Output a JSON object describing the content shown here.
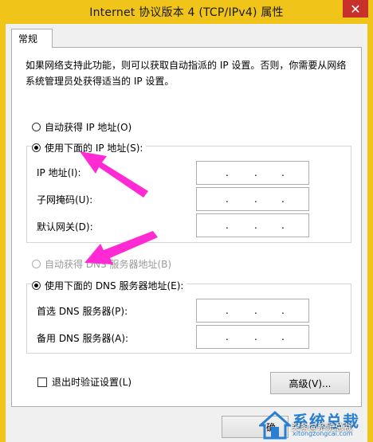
{
  "window": {
    "title": "Internet 协议版本 4 (TCP/IPv4) 属性",
    "close_symbol": "✕"
  },
  "tabs": [
    {
      "label": "常规"
    }
  ],
  "description": "如果网络支持此功能，则可以获取自动指派的 IP 设置。否则，你需要从网络系统管理员处获得适当的 IP 设置。",
  "ip_section": {
    "auto_label": "自动获得 IP 地址(O)",
    "manual_label": "使用下面的 IP 地址(S):",
    "selected": "manual",
    "fields": [
      {
        "label": "IP 地址(I):",
        "value": ". . ."
      },
      {
        "label": "子网掩码(U):",
        "value": ". . ."
      },
      {
        "label": "默认网关(D):",
        "value": ". . ."
      }
    ]
  },
  "dns_section": {
    "auto_label": "自动获得 DNS 服务器地址(B)",
    "auto_disabled": true,
    "manual_label": "使用下面的 DNS 服务器地址(E):",
    "selected": "manual",
    "fields": [
      {
        "label": "首选 DNS 服务器(P):",
        "value": ". . ."
      },
      {
        "label": "备用 DNS 服务器(A):",
        "value": ". . ."
      }
    ]
  },
  "validate_checkbox": {
    "label": "退出时验证设置(L)",
    "checked": false
  },
  "advanced_button": {
    "label": "高级(V)..."
  },
  "ok_button": {
    "label": "确"
  },
  "watermark": {
    "title": "系统总裁",
    "url": "xitongzongcai.com",
    "overlay": "头条@系统总裁"
  },
  "colors": {
    "title_bar": "#f0c419",
    "close_button": "#c7302b",
    "annotation_arrow": "#ff2ad4",
    "watermark_blue": "#2a7fd0"
  },
  "icons": {
    "close": "close-icon",
    "annotation_arrow": "arrow-icon",
    "watermark_logo": "house-logo-icon"
  }
}
